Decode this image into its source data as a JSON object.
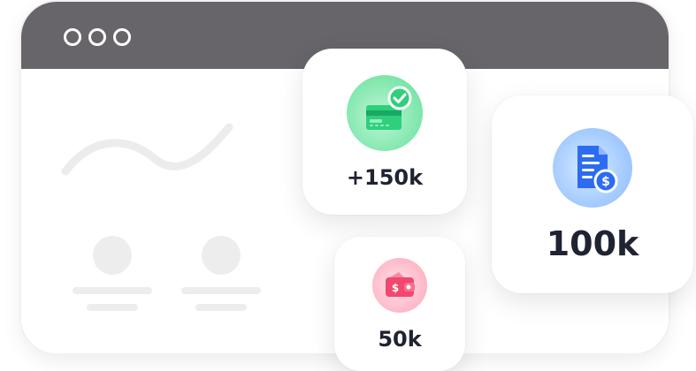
{
  "browser": {
    "window_buttons": [
      "dot",
      "dot",
      "dot"
    ],
    "bar_color": "#67656a"
  },
  "cards": {
    "income": {
      "icon": "credit-card-check-icon",
      "value": "+150k",
      "accent": "#2fcf7c"
    },
    "invoice": {
      "icon": "invoice-dollar-icon",
      "value": "100k",
      "accent": "#2d6cf0"
    },
    "wallet": {
      "icon": "wallet-dollar-icon",
      "value": "50k",
      "accent": "#f2476e"
    }
  }
}
